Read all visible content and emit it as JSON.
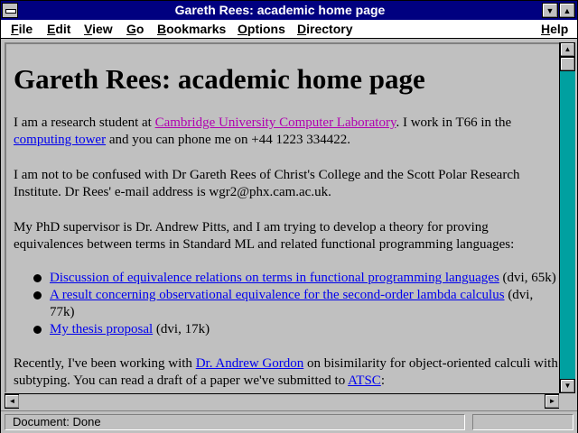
{
  "window": {
    "title": "Gareth Rees: academic home page",
    "minimize_glyph": "▼",
    "maximize_glyph": "▲",
    "system_menu_icon": "system-menu-icon"
  },
  "menubar": {
    "items": [
      {
        "pre": "",
        "key": "F",
        "post": "ile"
      },
      {
        "pre": "",
        "key": "E",
        "post": "dit"
      },
      {
        "pre": "",
        "key": "V",
        "post": "iew"
      },
      {
        "pre": "",
        "key": "G",
        "post": "o"
      },
      {
        "pre": "",
        "key": "B",
        "post": "ookmarks"
      },
      {
        "pre": "",
        "key": "O",
        "post": "ptions"
      },
      {
        "pre": "",
        "key": "D",
        "post": "irectory"
      },
      {
        "pre": "",
        "key": "H",
        "post": "elp"
      }
    ]
  },
  "page": {
    "heading": "Gareth Rees: academic home page",
    "p1": {
      "t1": "I am a research student at ",
      "link1": "Cambridge University Computer Laboratory",
      "t2": ". I work in T66 in the ",
      "link2": "computing tower",
      "t3": " and you can phone me on +44 1223 334422."
    },
    "p2": "I am not to be confused with Dr Gareth Rees of Christ's College and the Scott Polar Research Institute. Dr Rees' e-mail address is wgr2@phx.cam.ac.uk.",
    "p3": "My PhD supervisor is Dr. Andrew Pitts, and I am trying to develop a theory for proving equivalences between terms in Standard ML and related functional programming languages:",
    "list": [
      {
        "link": "Discussion of equivalence relations on terms in functional programming languages",
        "note": " (dvi, 65k)"
      },
      {
        "link": "A result concerning observational equivalence for the second-order lambda calculus",
        "note": " (dvi, 77k)"
      },
      {
        "link": "My thesis proposal",
        "note": " (dvi, 17k)"
      }
    ],
    "p4": {
      "t1": "Recently, I've been working with ",
      "link1": "Dr. Andrew Gordon",
      "t2": " on bisimilarity for object-oriented calculi with subtyping. You can read a draft of a paper we've submitted to ",
      "link2": "ATSC",
      "t3": ":"
    }
  },
  "scrollbars": {
    "up_glyph": "▲",
    "down_glyph": "▼",
    "left_glyph": "◄",
    "right_glyph": "►"
  },
  "status": {
    "text": "Document: Done"
  },
  "colors": {
    "titlebar": "#000080",
    "link": "#0000ee",
    "visited_link": "#b000b0",
    "scroll_track": "#00a0a0"
  }
}
